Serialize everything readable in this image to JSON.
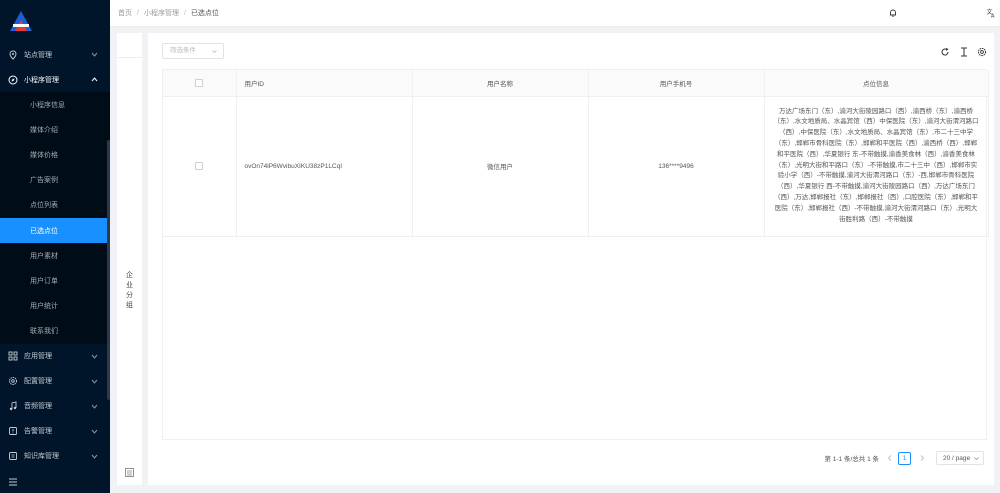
{
  "sidebar": {
    "menus": [
      {
        "label": "站点管理",
        "icon": "location-icon",
        "open": false
      },
      {
        "label": "小程序管理",
        "icon": "compass-icon",
        "open": true
      }
    ],
    "submenu": [
      {
        "label": "小程序信息",
        "active": false
      },
      {
        "label": "媒体介绍",
        "active": false
      },
      {
        "label": "媒体价格",
        "active": false
      },
      {
        "label": "广告案例",
        "active": false
      },
      {
        "label": "点位列表",
        "active": false
      },
      {
        "label": "已选点位",
        "active": true
      },
      {
        "label": "用户素材",
        "active": false
      },
      {
        "label": "用户订单",
        "active": false
      },
      {
        "label": "用户统计",
        "active": false
      },
      {
        "label": "联系我们",
        "active": false
      }
    ],
    "bottom_menus": [
      {
        "label": "应用管理",
        "icon": "apps-icon"
      },
      {
        "label": "配置管理",
        "icon": "gear-icon"
      },
      {
        "label": "音频管理",
        "icon": "music-icon"
      },
      {
        "label": "告警管理",
        "icon": "alarm-icon"
      },
      {
        "label": "知识库管理",
        "icon": "book-icon"
      }
    ]
  },
  "breadcrumb": [
    "首页",
    "小程序管理",
    "已选点位"
  ],
  "group_panel": {
    "label": "企业分组"
  },
  "filter": {
    "placeholder": "筛选条件"
  },
  "table": {
    "columns": [
      "用户ID",
      "用户名称",
      "用户手机号",
      "点位信息"
    ],
    "rows": [
      {
        "user_id": "ovOn74lP6WvibuXIKU38zP1LCqI",
        "user_name": "微信用户",
        "phone": "136****9496",
        "location_info": "万达广场东门（东）,渝河大街陵园路口（西）,渝西桥（东）,渝西桥（东）,水文地质局、水晶宾馆（西）中保医院（东）,渝河大街渭河路口（西）,中保医院（东）,水文地质局、水晶宾馆（东）,市二十三中学（东）,邯郸市骨科医院（东）,邯郸和平医院（西）,渝西桥（西）,邯郸和平医院（西）,华夏银行 东-不带触摸,渝香美食林（西）,渝香美食林（东）,光明大街和平路口（东）-不带触摸,市二十三中（西）,邯郸市实验小学（西）-不带触摸,渝河大街渭河路口（东）-西,邯郸市骨科医院（西）,华夏银行 西-不带触摸,渝河大街陵园路口（西）,万达广场东门（西）,万达,邯郸报社（东）,邯郸报社（西）,口腔医院（东）,邯郸和平医院（东）,邯郸报社（西）-不带触摸,渝河大街渭河路口（东）,光明大街胜利路（西）-不带触摸"
      }
    ]
  },
  "pagination": {
    "summary": "第 1-1 条/总共 1 条",
    "current_page": "1",
    "page_size": "20 / page"
  }
}
